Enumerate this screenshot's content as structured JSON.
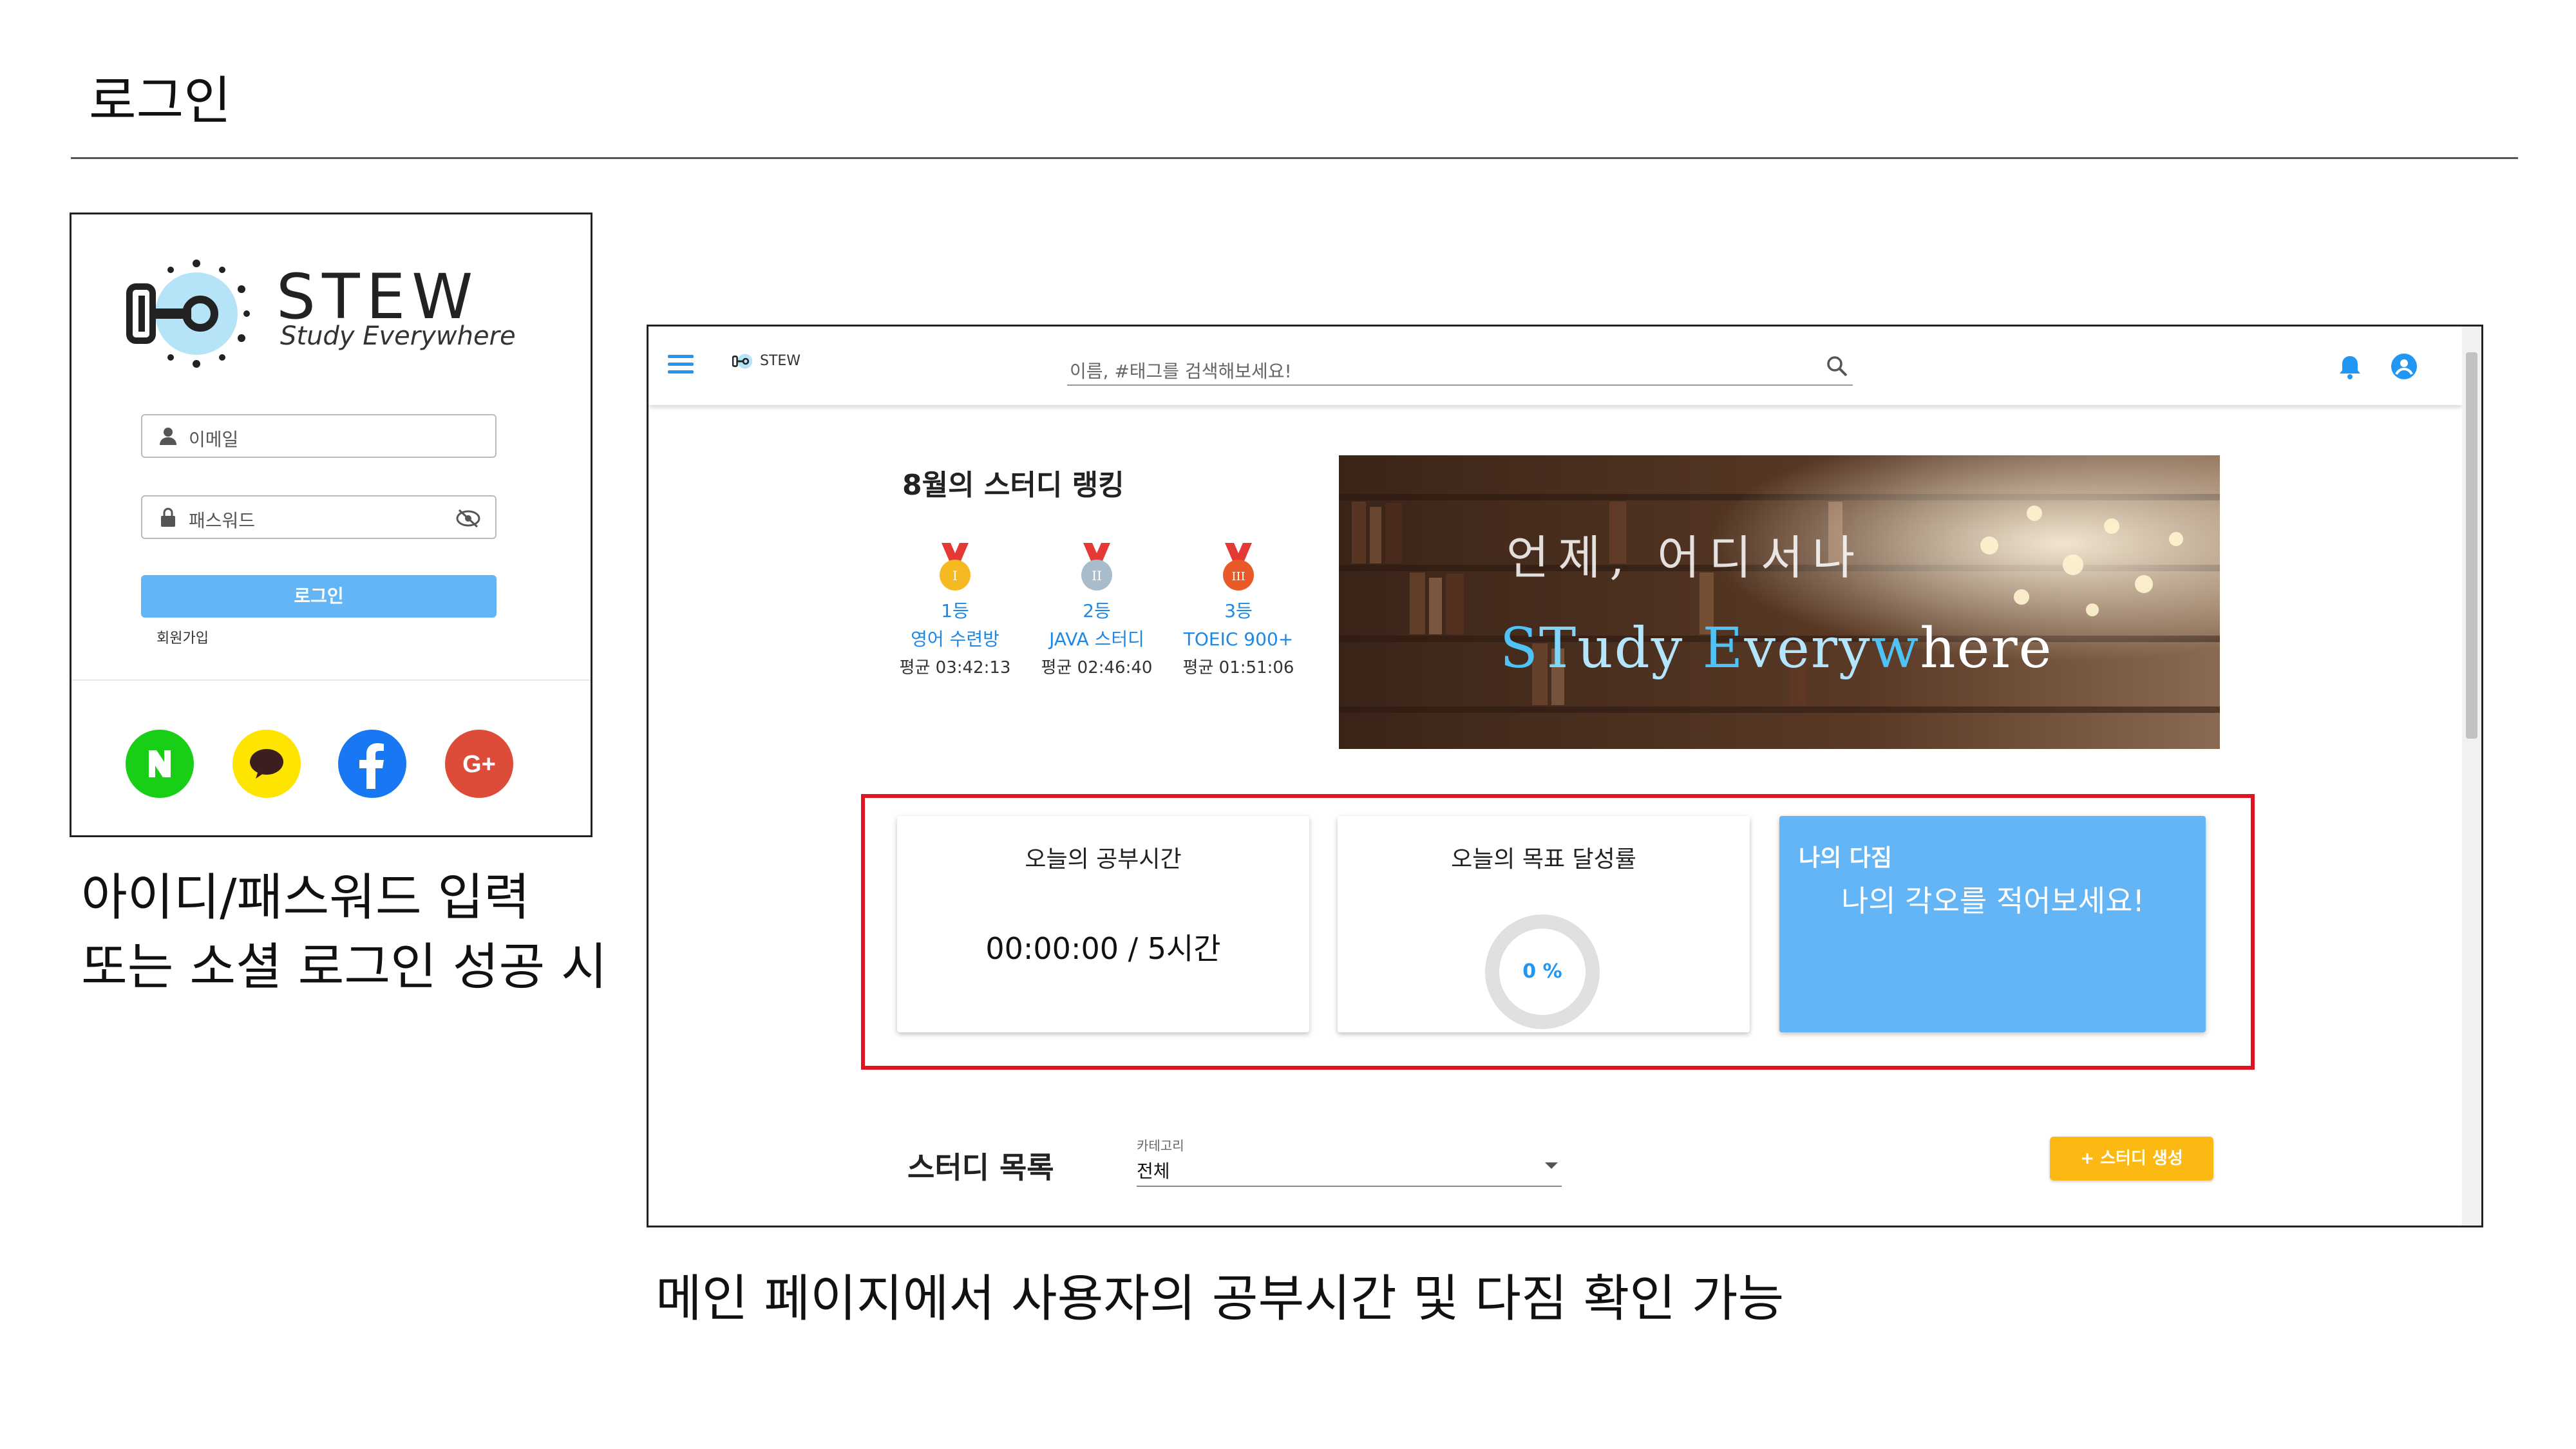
{
  "slide": {
    "title": "로그인",
    "caption_left_line1": "아이디/패스워드 입력",
    "caption_left_line2": "또는 소셜 로그인 성공 시",
    "caption_bottom": "메인 페이지에서 사용자의 공부시간 및 다짐 확인 가능"
  },
  "login": {
    "logo_text": "STEW",
    "logo_sub": "Study Everywhere",
    "email_placeholder": "이메일",
    "password_placeholder": "패스워드",
    "login_button": "로그인",
    "signup_link": "회원가입",
    "social": [
      {
        "name": "naver",
        "glyph": "N",
        "color": "#19ce16"
      },
      {
        "name": "kakao",
        "glyph": "",
        "color": "#fee500"
      },
      {
        "name": "facebook",
        "glyph": "f",
        "color": "#1877f2"
      },
      {
        "name": "google",
        "glyph": "G+",
        "color": "#dd4b39"
      }
    ]
  },
  "app": {
    "logo_text": "STEW",
    "search_placeholder": "이름, #태그를 검색해보세요!",
    "ranking": {
      "title": "8월의 스터디 랭킹",
      "items": [
        {
          "rank": "1등",
          "name": "영어 수련방",
          "avg": "평균 03:42:13",
          "medal_color": "#f5b921",
          "medal_mark": "I"
        },
        {
          "rank": "2등",
          "name": "JAVA 스터디",
          "avg": "평균 02:46:40",
          "medal_color": "#a9bccc",
          "medal_mark": "II"
        },
        {
          "rank": "3등",
          "name": "TOEIC 900+",
          "avg": "평균 01:51:06",
          "medal_color": "#ea5a28",
          "medal_mark": "III"
        }
      ]
    },
    "banner": {
      "line1": "언제, 어디서나",
      "line2": "STudy EveryWhere"
    },
    "study_time": {
      "title": "오늘의 공부시간",
      "value": "00:00:00 / 5시간"
    },
    "goal": {
      "title": "오늘의 목표 달성률",
      "percent_label": "0 %",
      "progress": 0
    },
    "pledge": {
      "title": "나의 다짐",
      "body": "나의 각오를 적어보세요!"
    },
    "study_list": {
      "title": "스터디 목록",
      "category_label": "카테고리",
      "category_value": "전체",
      "create_button": "+ 스터디 생성"
    }
  }
}
